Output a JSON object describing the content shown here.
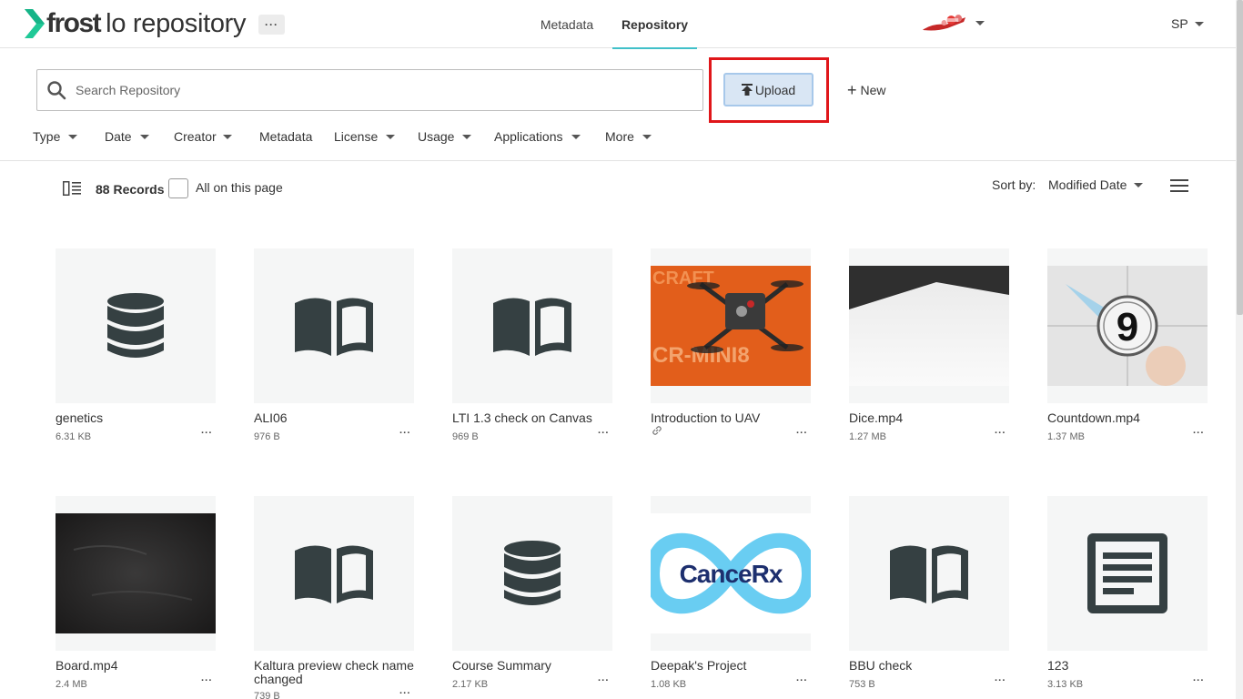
{
  "header": {
    "logo_brand": "frost",
    "logo_product": "lo repository",
    "more_label": "···",
    "tabs": [
      {
        "label": "Metadata"
      },
      {
        "label": "Repository",
        "active": true
      }
    ],
    "tenant_logo": "tenant-logo",
    "user_initials": "SP"
  },
  "search": {
    "placeholder": "Search Repository"
  },
  "actions": {
    "upload_label": "Upload",
    "new_label": "New"
  },
  "filters": [
    {
      "label": "Type",
      "dropdown": true
    },
    {
      "label": "Date",
      "dropdown": true
    },
    {
      "label": "Creator",
      "dropdown": true
    },
    {
      "label": "Metadata",
      "dropdown": false
    },
    {
      "label": "License",
      "dropdown": true
    },
    {
      "label": "Usage",
      "dropdown": true
    },
    {
      "label": "Applications",
      "dropdown": true
    },
    {
      "label": "More",
      "dropdown": true
    }
  ],
  "records": {
    "count_label": "88 Records",
    "select_all_label": "All on this page",
    "sort_by_label": "Sort by:",
    "sort_value": "Modified Date"
  },
  "items": [
    {
      "title": "genetics",
      "size": "6.31 KB",
      "thumb": "database-icon",
      "more": "···"
    },
    {
      "title": "ALI06",
      "size": "976 B",
      "thumb": "book-icon",
      "more": "···"
    },
    {
      "title": "LTI 1.3 check on Canvas",
      "size": "969 B",
      "thumb": "book-icon",
      "more": "···"
    },
    {
      "title": "Introduction to UAV",
      "size": "",
      "thumb": "drone-image",
      "linked": true,
      "more": "···"
    },
    {
      "title": "Dice.mp4",
      "size": "1.27 MB",
      "thumb": "dice-video",
      "more": "···"
    },
    {
      "title": "Countdown.mp4",
      "size": "1.37 MB",
      "thumb": "countdown-video",
      "more": "···"
    },
    {
      "title": "Board.mp4",
      "size": "2.4 MB",
      "thumb": "board-video",
      "more": "···"
    },
    {
      "title": "Kaltura preview check name changed",
      "size": "739 B",
      "thumb": "book-icon",
      "more": "···"
    },
    {
      "title": "Course Summary",
      "size": "2.17 KB",
      "thumb": "database-icon",
      "more": "···"
    },
    {
      "title": "Deepak's Project",
      "size": "1.08 KB",
      "thumb": "cancerx-image",
      "more": "···"
    },
    {
      "title": "BBU check",
      "size": "753 B",
      "thumb": "book-icon",
      "more": "···"
    },
    {
      "title": "123",
      "size": "3.13 KB",
      "thumb": "document-icon",
      "more": "···"
    }
  ],
  "thumb_text": {
    "drone_line1": "CRAFT",
    "drone_line2": "CR-MINI8",
    "countdown_digit": "9",
    "cancerx_text": "CanceRx"
  },
  "colors": {
    "accent_tab": "#41c0c9",
    "upload_bg": "#d9e6f4",
    "highlight": "#e0161a",
    "icon_dark": "#354042"
  }
}
